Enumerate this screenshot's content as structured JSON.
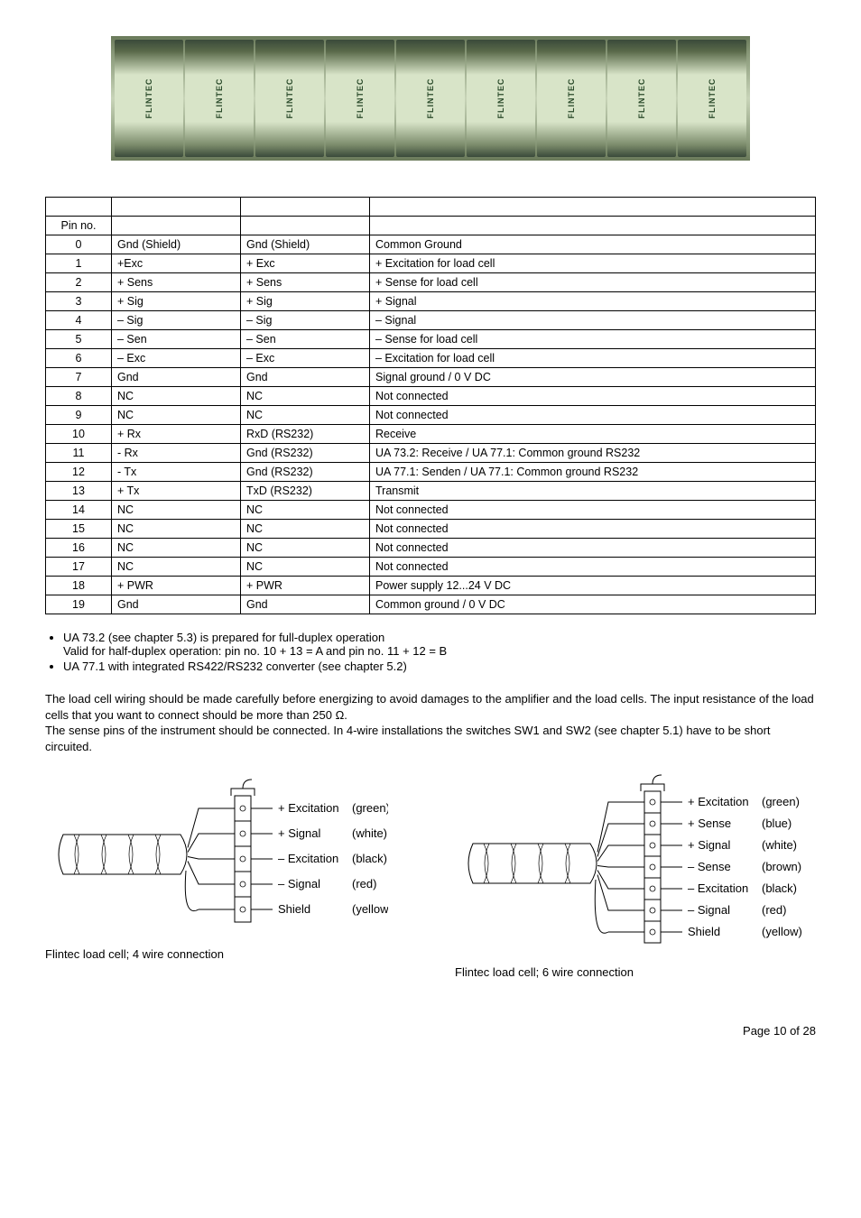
{
  "table": {
    "header": {
      "pin": "Pin no."
    },
    "rows": [
      {
        "pin": "0",
        "a": "Gnd (Shield)",
        "b": "Gnd (Shield)",
        "desc": "Common Ground"
      },
      {
        "pin": "1",
        "a": "+Exc",
        "b": "+ Exc",
        "desc": "+ Excitation for load cell"
      },
      {
        "pin": "2",
        "a": "+ Sens",
        "b": "+ Sens",
        "desc": "+ Sense for load cell"
      },
      {
        "pin": "3",
        "a": "+ Sig",
        "b": "+ Sig",
        "desc": "+ Signal"
      },
      {
        "pin": "4",
        "a": "– Sig",
        "b": "– Sig",
        "desc": "– Signal"
      },
      {
        "pin": "5",
        "a": "– Sen",
        "b": "– Sen",
        "desc": "– Sense for load cell"
      },
      {
        "pin": "6",
        "a": "– Exc",
        "b": "– Exc",
        "desc": "– Excitation for load cell"
      },
      {
        "pin": "7",
        "a": "Gnd",
        "b": "Gnd",
        "desc": "Signal ground / 0 V DC"
      },
      {
        "pin": "8",
        "a": "NC",
        "b": "NC",
        "desc": "Not connected"
      },
      {
        "pin": "9",
        "a": "NC",
        "b": "NC",
        "desc": "Not connected"
      },
      {
        "pin": "10",
        "a": "+ Rx",
        "b": "RxD (RS232)",
        "desc": "Receive"
      },
      {
        "pin": "11",
        "a": "- Rx",
        "b": "Gnd (RS232)",
        "desc": "UA 73.2: Receive / UA 77.1: Common ground RS232"
      },
      {
        "pin": "12",
        "a": "- Tx",
        "b": "Gnd (RS232)",
        "desc": "UA 77.1: Senden / UA 77.1: Common ground RS232"
      },
      {
        "pin": "13",
        "a": "+ Tx",
        "b": "TxD (RS232)",
        "desc": "Transmit"
      },
      {
        "pin": "14",
        "a": "NC",
        "b": "NC",
        "desc": "Not connected"
      },
      {
        "pin": "15",
        "a": "NC",
        "b": "NC",
        "desc": "Not connected"
      },
      {
        "pin": "16",
        "a": "NC",
        "b": "NC",
        "desc": "Not connected"
      },
      {
        "pin": "17",
        "a": "NC",
        "b": "NC",
        "desc": "Not connected"
      },
      {
        "pin": "18",
        "a": "+ PWR",
        "b": "+ PWR",
        "desc": "Power supply 12...24 V DC"
      },
      {
        "pin": "19",
        "a": "Gnd",
        "b": "Gnd",
        "desc": "Common ground / 0 V DC"
      }
    ]
  },
  "bullets": {
    "b1_line1": "UA 73.2 (see chapter 5.3) is prepared for full-duplex operation",
    "b1_line2": "Valid for half-duplex operation: pin no. 10 + 13 = A  and  pin no. 11 + 12 = B",
    "b2": "UA 77.1 with integrated RS422/RS232 converter (see chapter 5.2)"
  },
  "paragraph": "The load cell wiring should be made carefully before energizing to avoid damages to the amplifier and the load cells. The input resistance of the load cells that you want to connect should be more than 250 Ω.\nThe sense pins of the instrument should be connected. In 4-wire installations the switches SW1 and SW2 (see chapter 5.1) have to be short circuited.",
  "diagram4": {
    "lines": [
      {
        "label": "+ Excitation",
        "color": "(green)"
      },
      {
        "label": "+ Signal",
        "color": "(white)"
      },
      {
        "label": "– Excitation",
        "color": "(black)"
      },
      {
        "label": "– Signal",
        "color": "(red)"
      },
      {
        "label": "Shield",
        "color": "(yellow)"
      }
    ],
    "caption": "Flintec load cell; 4 wire connection"
  },
  "diagram6": {
    "lines": [
      {
        "label": "+ Excitation",
        "color": "(green)"
      },
      {
        "label": "+ Sense",
        "color": "(blue)"
      },
      {
        "label": "+ Signal",
        "color": "(white)"
      },
      {
        "label": "– Sense",
        "color": "(brown)"
      },
      {
        "label": "– Excitation",
        "color": "(black)"
      },
      {
        "label": "– Signal",
        "color": "(red)"
      },
      {
        "label": "Shield",
        "color": "(yellow)"
      }
    ],
    "caption": "Flintec load cell; 6 wire connection"
  },
  "footer": "Page 10 of 28"
}
